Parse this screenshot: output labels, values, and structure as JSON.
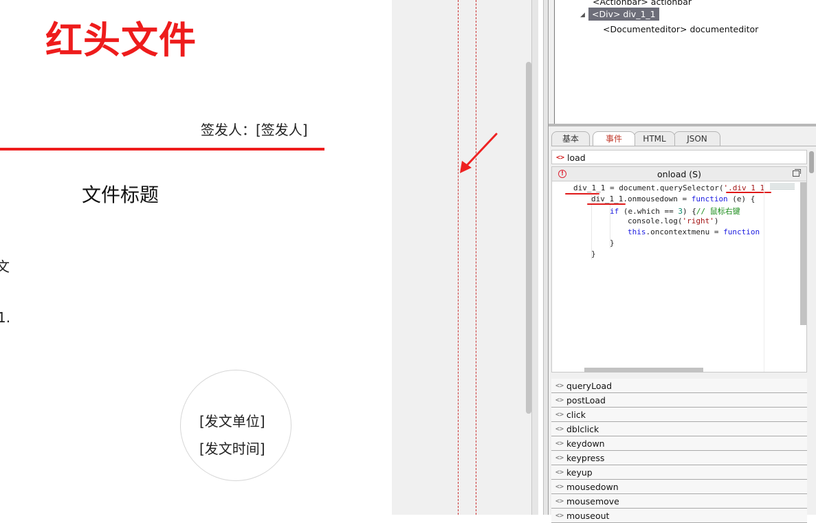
{
  "document": {
    "title": "红头文件",
    "signer": "签发人：[签发人]",
    "heading": "文件标题",
    "body_fragment_1": "文",
    "body_fragment_2": "1.",
    "seal_unit": "[发文单位]",
    "seal_time": "[发文时间]"
  },
  "tree": {
    "row_0": "<Actionbar> actionbar",
    "toggle": "◢",
    "row_1": "<Div> div_1_1",
    "row_2": "<Documenteditor> documenteditor"
  },
  "tabs": [
    {
      "label": "基本",
      "active": false
    },
    {
      "label": "事件",
      "active": true
    },
    {
      "label": "HTML",
      "active": false
    },
    {
      "label": "JSON",
      "active": false
    }
  ],
  "events": {
    "icon": "<>",
    "load": "load",
    "editor_title": "onload (S)",
    "editor_error_icon": "!",
    "list": [
      "queryLoad",
      "postLoad",
      "click",
      "dblclick",
      "keydown",
      "keypress",
      "keyup",
      "mousedown",
      "mousemove",
      "mouseout"
    ]
  },
  "code": {
    "line_1": {
      "a": "div_1_1 = document.querySelector(",
      "b": "'.div_1_1"
    },
    "line_2": {
      "a": "div_1_1.onmousedown = ",
      "kw": "function",
      "b": " (e) {"
    },
    "line_3": {
      "kw": "if",
      "a": " (e.which == ",
      "num": "3",
      "b": ") {",
      "cm": "// 鼠标右键"
    },
    "line_4": {
      "a": "console.log(",
      "str": "'right'",
      "b": ")"
    },
    "line_5": {
      "kw1": "this",
      "a": ".oncontextmenu = ",
      "kw2": "function"
    },
    "line_6": "}",
    "line_7": "}"
  },
  "colors": {
    "accent_red": "#ee1c1c",
    "tree_selection": "#6d6e79",
    "keyword_blue": "#1a1ae0",
    "comment_green": "#1a8c1a"
  }
}
